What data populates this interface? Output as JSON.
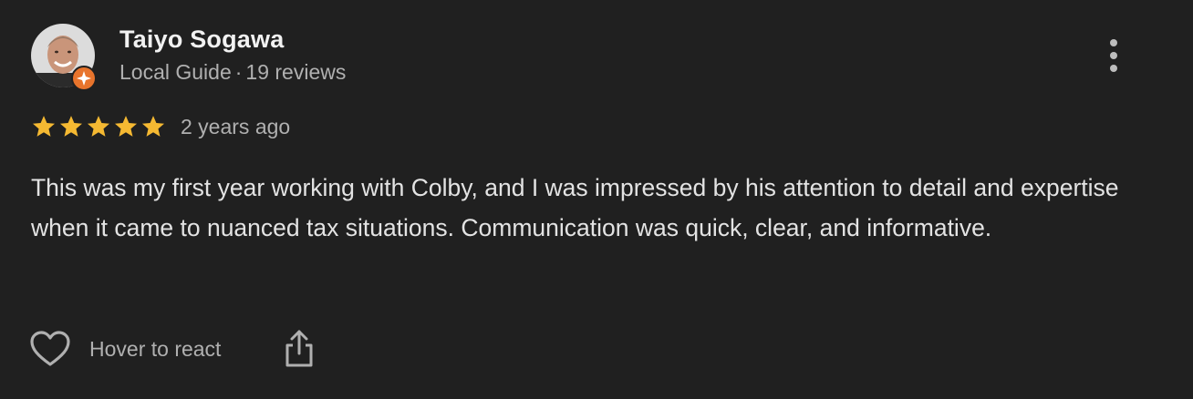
{
  "review": {
    "author": {
      "name": "Taiyo Sogawa",
      "role": "Local Guide",
      "separator": "·",
      "review_count": "19 reviews"
    },
    "rating": 5,
    "rating_max": 5,
    "date": "2 years ago",
    "text": "This was my first year working with Colby, and I was impressed by his attention to detail and expertise when it came to nuanced tax situations. Communication was quick, clear, and informative."
  },
  "actions": {
    "react_label": "Hover to react"
  },
  "icons": {
    "more": "more-vert-icon",
    "star": "star-icon",
    "heart": "heart-icon",
    "share": "share-icon",
    "badge": "local-guide-badge-icon"
  },
  "colors": {
    "background": "#202020",
    "star": "#f5b932",
    "badge": "#e8742c",
    "text_primary": "#f2f2f2",
    "text_secondary": "#b0b0b0"
  }
}
